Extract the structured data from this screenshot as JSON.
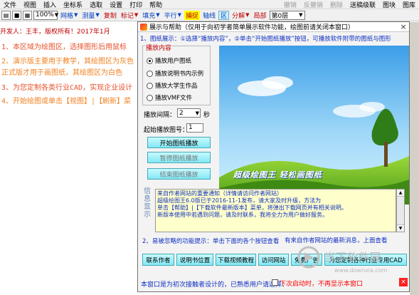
{
  "menubar": {
    "left": [
      "文件",
      "视图",
      "插入",
      "坐标系",
      "选取",
      "设置",
      "打印",
      "帮助"
    ],
    "right": [
      "撤销",
      "反撤销",
      "删除",
      "送稿级联",
      "图块",
      "图库"
    ]
  },
  "toolbar": {
    "zoom": "100%",
    "grid": "网格",
    "measure": "测量",
    "copy": "复制",
    "mark": "标记",
    "fill": "填充",
    "parallel": "平行",
    "snap": "捕捉",
    "axis": "轴线",
    "area": "区",
    "split": "分解",
    "local": "局部",
    "layer": "第0层"
  },
  "left_panel": {
    "developer": "开发人：王丰，版权所有！2017年1月",
    "lines": [
      "1、本区域为绘图区，选择图形后用鼠标",
      "2、演示版主要用于教学，其绘图区为灰色",
      "   正式版才用于画图纸，其绘图区为白色",
      "3、为您定制各类行业CAD，实现企业设计",
      "4、开始绘图或单击【视图】|【刷新】菜"
    ]
  },
  "dialog": {
    "title": "展示与帮助（仅用于向初学者简单展示软件功能，绘图前请关闭本窗口）",
    "close": "×",
    "step1": "1、图纸展示：①选择“播放内容”，②单击“开始图纸播放”按钮，可播放软件附带的图纸与图形",
    "group_title": "播放内容",
    "options": [
      "播放用户图纸",
      "播放说明书内示例",
      "播放大学生作品",
      "播放VMF文件"
    ],
    "interval_label": "播放间隔：",
    "interval_value": "2",
    "seconds": "秒",
    "start_no_label": "起始播放图号：",
    "start_no_value": "1",
    "buttons": {
      "start": "开始图纸播放",
      "pause": "暂停图纸播放",
      "stop": "结束图纸播放"
    },
    "vertical_label": "信息显示",
    "picture_text": "超级绘图王  轻松画图纸",
    "notice": [
      "来自作者网站的重要通知（详情请访问作者网站）",
      "   超级绘图王6.0版已于2016-11-1发布，请大家及时升级，方法为",
      "   单击【帮助】|【下载软件最新版本】菜单，将弹出下载网页并有相关说明。",
      "   新版本使用中若遇到问题，请及时联系，我将全力为用户做好服务。"
    ],
    "step2": "2、易被忽略的功能提示：单击下面的各个按钮查看",
    "latest": "有来自作者网站的最新消息，上面查看",
    "bottom_buttons": [
      "联系作者",
      "说明书位置",
      "下载视频教程",
      "访问网站",
      "免费广告",
      "为您定制各种行业专用CAD"
    ],
    "footer": "本窗口是为初次接触者设计的，已熟悉用户请选择：",
    "footer_red": "下次启动时，不再显示本窗口",
    "footer_close": "×"
  },
  "watermark": {
    "text": "当下软件园",
    "url": "www.downxia.com"
  }
}
